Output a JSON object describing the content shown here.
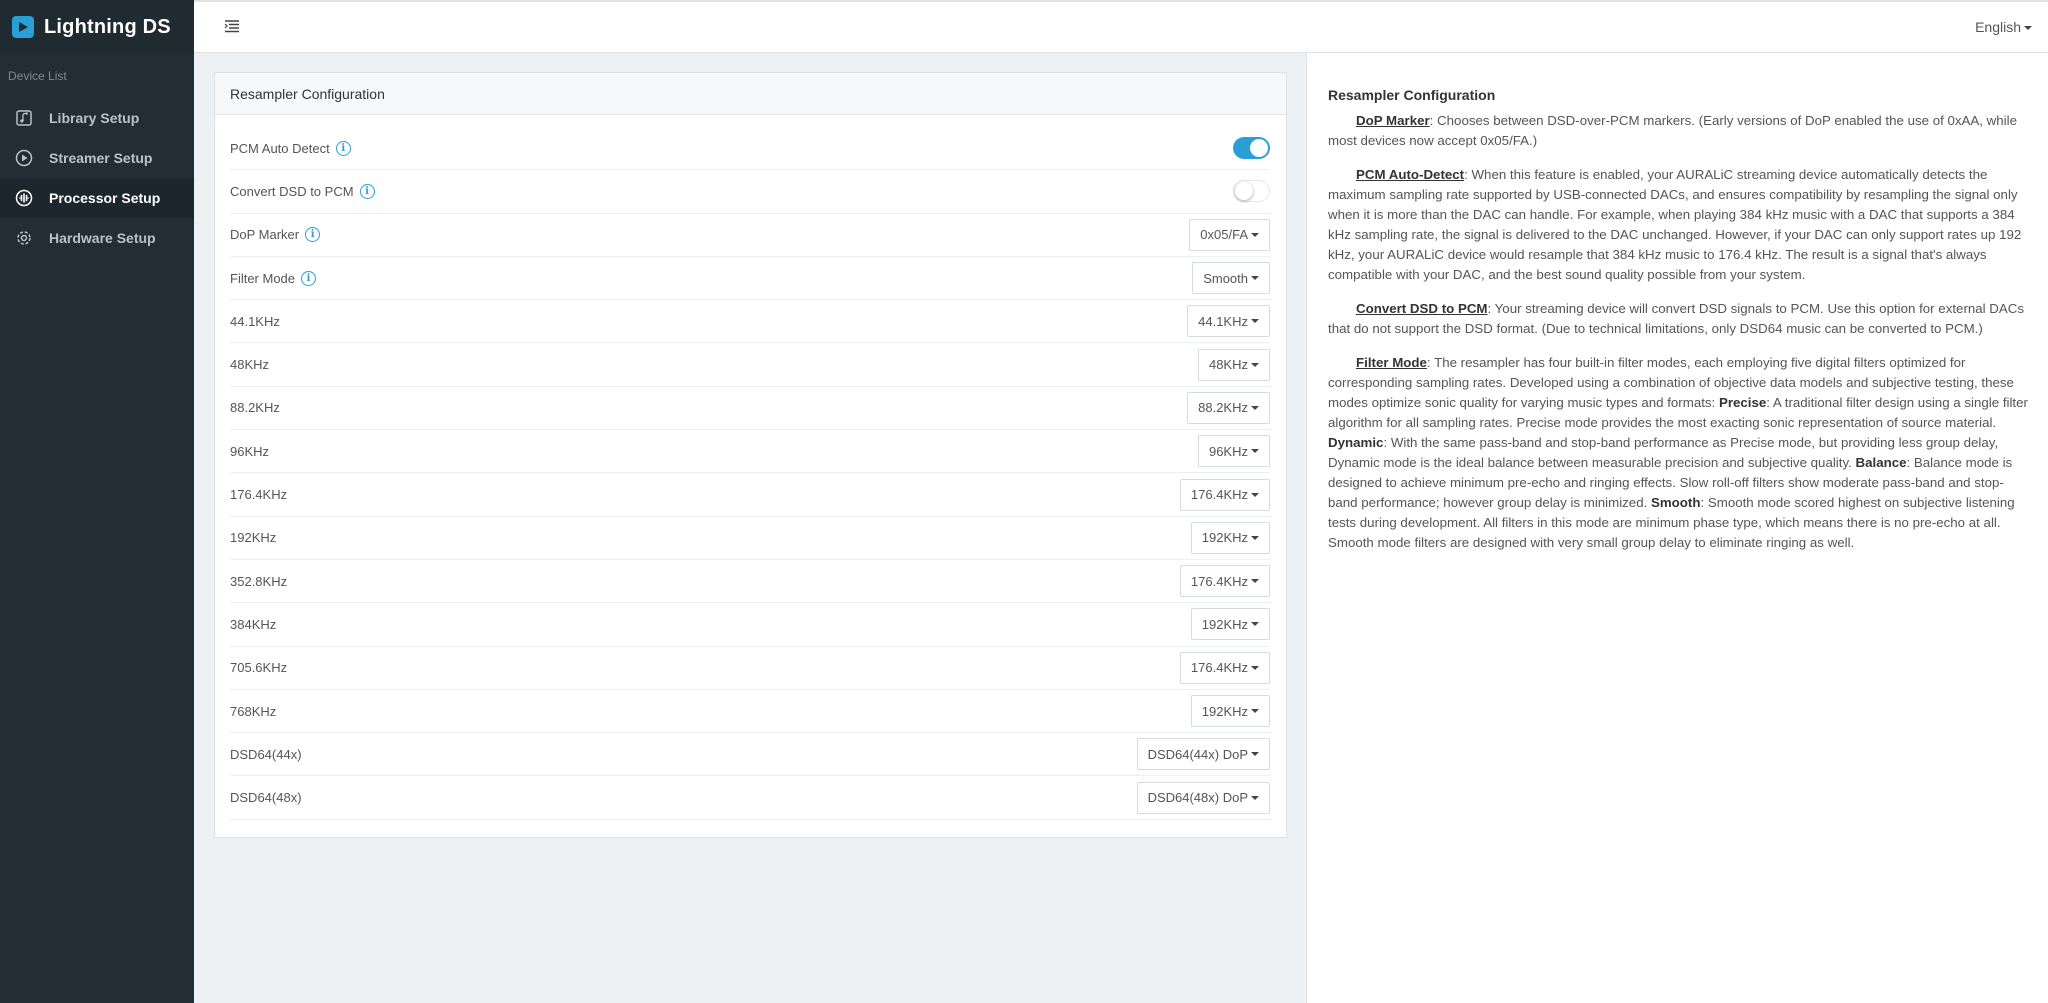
{
  "app": {
    "name": "Lightning DS"
  },
  "sidebar": {
    "section_label": "Device List",
    "items": [
      {
        "label": "Library Setup",
        "icon": "library-icon",
        "active": false
      },
      {
        "label": "Streamer Setup",
        "icon": "play-circle-icon",
        "active": false
      },
      {
        "label": "Processor Setup",
        "icon": "processor-icon",
        "active": true
      },
      {
        "label": "Hardware Setup",
        "icon": "gear-icon",
        "active": false
      }
    ]
  },
  "topbar": {
    "language": "English"
  },
  "panel": {
    "title": "Resampler Configuration",
    "pcm_auto_detect": {
      "label": "PCM Auto Detect",
      "enabled": true
    },
    "convert_dsd": {
      "label": "Convert DSD to PCM",
      "enabled": false
    },
    "dop_marker": {
      "label": "DoP Marker",
      "value": "0x05/FA"
    },
    "filter_mode": {
      "label": "Filter Mode",
      "value": "Smooth"
    },
    "rates": [
      {
        "label": "44.1KHz",
        "value": "44.1KHz"
      },
      {
        "label": "48KHz",
        "value": "48KHz"
      },
      {
        "label": "88.2KHz",
        "value": "88.2KHz"
      },
      {
        "label": "96KHz",
        "value": "96KHz"
      },
      {
        "label": "176.4KHz",
        "value": "176.4KHz"
      },
      {
        "label": "192KHz",
        "value": "192KHz"
      },
      {
        "label": "352.8KHz",
        "value": "176.4KHz"
      },
      {
        "label": "384KHz",
        "value": "192KHz"
      },
      {
        "label": "705.6KHz",
        "value": "176.4KHz"
      },
      {
        "label": "768KHz",
        "value": "192KHz"
      },
      {
        "label": "DSD64(44x)",
        "value": "DSD64(44x) DoP"
      },
      {
        "label": "DSD64(48x)",
        "value": "DSD64(48x) DoP"
      }
    ]
  },
  "help": {
    "title": "Resampler Configuration",
    "dop": {
      "term": "DoP Marker",
      "text": ": Chooses between DSD-over-PCM markers. (Early versions of DoP enabled the use of 0xAA, while most devices now accept 0x05/FA.)"
    },
    "pcm": {
      "term": "PCM Auto-Detect",
      "text": ": When this feature is enabled, your AURALiC streaming device automatically detects the maximum sampling rate supported by USB-connected DACs, and ensures compatibility by resampling the signal only when it is more than the DAC can handle. For example, when playing 384 kHz music with a DAC that supports a 384 kHz sampling rate, the signal is delivered to the DAC unchanged. However, if your DAC can only support rates up 192 kHz, your AURALiC device would resample that 384 kHz music to 176.4 kHz. The result is a signal that's always compatible with your DAC, and the best sound quality possible from your system."
    },
    "convert": {
      "term": "Convert DSD to PCM",
      "text": ": Your streaming device will convert DSD signals to PCM. Use this option for external DACs that do not support the DSD format. (Due to technical limitations, only DSD64 music can be converted to PCM.)"
    },
    "filter": {
      "term": "Filter Mode",
      "intro": ": The resampler has four built-in filter modes, each employing five digital filters optimized for corresponding sampling rates. Developed using a combination of objective data models and subjective testing, these modes optimize sonic quality for varying music types and formats: ",
      "precise_term": "Precise",
      "precise_text": ": A traditional filter design using a single filter algorithm for all sampling rates. Precise mode provides the most exacting sonic representation of source material. ",
      "dynamic_term": "Dynamic",
      "dynamic_text": ": With the same pass-band and stop-band performance as Precise mode, but providing less group delay, Dynamic mode is the ideal balance between measurable precision and subjective quality. ",
      "balance_term": "Balance",
      "balance_text": ": Balance mode is designed to achieve minimum pre-echo and ringing effects. Slow roll-off filters show moderate pass-band and stop-band performance; however group delay is minimized. ",
      "smooth_term": "Smooth",
      "smooth_text": ": Smooth mode scored highest on subjective listening tests during development. All filters in this mode are minimum phase type, which means there is no pre-echo at all. Smooth mode filters are designed with very small group delay to eliminate ringing as well."
    }
  }
}
